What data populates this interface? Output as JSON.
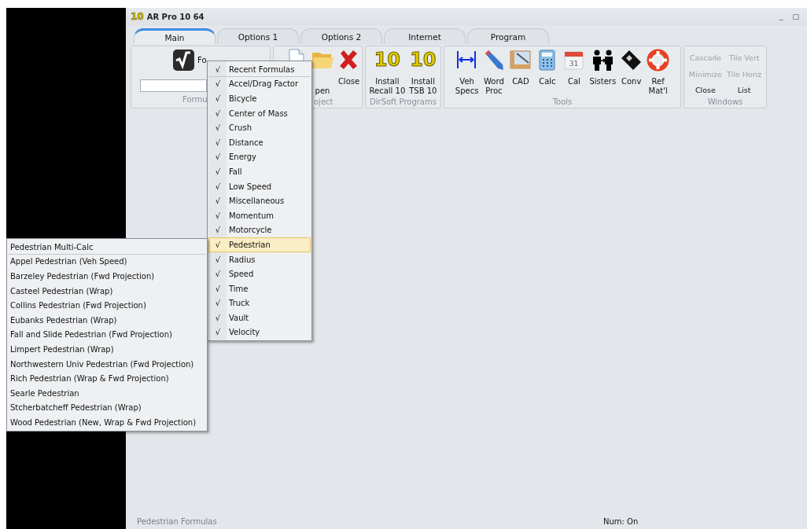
{
  "window": {
    "logo": "10",
    "title": "AR Pro 10 64",
    "controls": [
      "_",
      "□"
    ]
  },
  "tabs": [
    {
      "label": "Main",
      "selected": true
    },
    {
      "label": "Options 1",
      "selected": false
    },
    {
      "label": "Options 2",
      "selected": false
    },
    {
      "label": "Internet",
      "selected": false
    },
    {
      "label": "Program",
      "selected": false
    }
  ],
  "ribbon": [
    {
      "label": "Formu",
      "kind": "formula",
      "buttons": [
        {
          "label": "Fo"
        }
      ]
    },
    {
      "label": "oject",
      "kind": "project",
      "buttons": [
        {
          "label": "pen"
        },
        {
          "label": "Close"
        }
      ]
    },
    {
      "label": "DirSoft Programs",
      "kind": "buttons",
      "buttons": [
        {
          "label": "Install\nRecall 10",
          "glyph": "10"
        },
        {
          "label": "Install\nTSB 10",
          "glyph": "10"
        }
      ]
    },
    {
      "label": "Tools",
      "kind": "buttons",
      "buttons": [
        {
          "label": "Veh\nSpecs"
        },
        {
          "label": "Word\nProc"
        },
        {
          "label": "CAD"
        },
        {
          "label": "Calc"
        },
        {
          "label": "Cal",
          "glyph": "31"
        },
        {
          "label": "Sisters"
        },
        {
          "label": "Conv"
        },
        {
          "label": "Ref\nMat'l"
        }
      ]
    },
    {
      "label": "Windows",
      "kind": "grid",
      "buttons": [
        {
          "label": "Cascade",
          "disabled": true
        },
        {
          "label": "Tile Vert",
          "disabled": true
        },
        {
          "label": "Minimize",
          "disabled": true
        },
        {
          "label": "Tile Horiz",
          "disabled": true
        },
        {
          "label": "Close",
          "disabled": false
        },
        {
          "label": "List",
          "disabled": false
        }
      ]
    }
  ],
  "formula_menu": [
    {
      "check": "√",
      "label": "Recent Formulas",
      "kind": "header",
      "selected": false
    },
    {
      "check": "√",
      "label": "Accel/Drag Factor",
      "kind": "item",
      "selected": false
    },
    {
      "check": "√",
      "label": "Bicycle",
      "kind": "item",
      "selected": false
    },
    {
      "check": "√",
      "label": "Center of Mass",
      "kind": "item",
      "selected": false
    },
    {
      "check": "√",
      "label": "Crush",
      "kind": "item",
      "selected": false
    },
    {
      "check": "√",
      "label": "Distance",
      "kind": "item",
      "selected": false
    },
    {
      "check": "√",
      "label": "Energy",
      "kind": "item",
      "selected": false
    },
    {
      "check": "√",
      "label": "Fall",
      "kind": "item",
      "selected": false
    },
    {
      "check": "√",
      "label": "Low Speed",
      "kind": "item",
      "selected": false
    },
    {
      "check": "√",
      "label": "Miscellaneous",
      "kind": "item",
      "selected": false
    },
    {
      "check": "√",
      "label": "Momentum",
      "kind": "item",
      "selected": false
    },
    {
      "check": "√",
      "label": "Motorcycle",
      "kind": "item",
      "selected": false
    },
    {
      "check": "√",
      "label": "Pedestrian",
      "kind": "item",
      "selected": true
    },
    {
      "check": "√",
      "label": "Radius",
      "kind": "item",
      "selected": false
    },
    {
      "check": "√",
      "label": "Speed",
      "kind": "item",
      "selected": false
    },
    {
      "check": "√",
      "label": "Time",
      "kind": "item",
      "selected": false
    },
    {
      "check": "√",
      "label": "Truck",
      "kind": "item",
      "selected": false
    },
    {
      "check": "√",
      "label": "Vault",
      "kind": "item",
      "selected": false
    },
    {
      "check": "√",
      "label": "Velocity",
      "kind": "item",
      "selected": false
    }
  ],
  "pedestrian_menu": [
    {
      "label": "Pedestrian Multi-Calc",
      "kind": "header"
    },
    {
      "label": "Appel Pedestrian (Veh Speed)",
      "kind": "item"
    },
    {
      "label": "Barzeley Pedestrian (Fwd Projection)",
      "kind": "item"
    },
    {
      "label": "Casteel Pedestrian (Wrap)",
      "kind": "item"
    },
    {
      "label": "Collins Pedestrian (Fwd Projection)",
      "kind": "item"
    },
    {
      "label": "Eubanks Pedestrian (Wrap)",
      "kind": "item"
    },
    {
      "label": "Fall and Slide Pedestrian (Fwd Projection)",
      "kind": "item"
    },
    {
      "label": "Limpert Pedestrian (Wrap)",
      "kind": "item"
    },
    {
      "label": "Northwestern Univ Pedestrian (Fwd Projection)",
      "kind": "item"
    },
    {
      "label": "Rich Pedestrian (Wrap & Fwd Projection)",
      "kind": "item"
    },
    {
      "label": "Searle Pedestrian",
      "kind": "item"
    },
    {
      "label": "Stcherbatcheff Pedestrian (Wrap)",
      "kind": "item"
    },
    {
      "label": "Wood Pedestrian (New, Wrap & Fwd Projection)",
      "kind": "item"
    }
  ],
  "status_bar": {
    "message": "Pedestrian Formulas",
    "num": "Num: On"
  }
}
